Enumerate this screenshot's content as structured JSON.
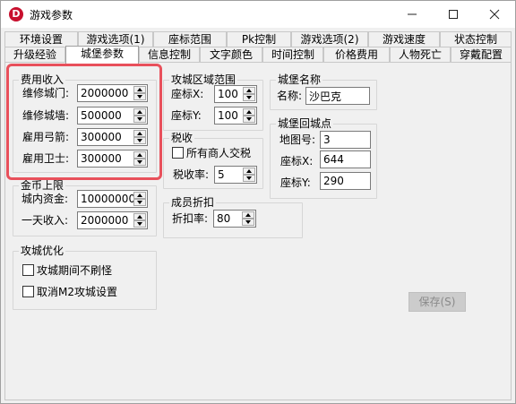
{
  "window": {
    "title": "游戏参数",
    "icon_letter": "D",
    "minimize_symbol": "—",
    "close_symbol": "✕"
  },
  "tabs_row1": [
    "环境设置",
    "游戏选项(1)",
    "座标范围",
    "Pk控制",
    "游戏选项(2)",
    "游戏速度",
    "状态控制"
  ],
  "tabs_row2": [
    "升级经验",
    "城堡参数",
    "信息控制",
    "文字颜色",
    "时间控制",
    "价格费用",
    "人物死亡",
    "穿戴配置"
  ],
  "active_tab": "城堡参数",
  "cost_group": {
    "title": "费用收入",
    "rows": [
      {
        "label": "维修城门:",
        "value": "2000000"
      },
      {
        "label": "维修城墙:",
        "value": "500000"
      },
      {
        "label": "雇用弓箭:",
        "value": "300000"
      },
      {
        "label": "雇用卫士:",
        "value": "300000"
      }
    ]
  },
  "gold_group": {
    "title": "金币上限",
    "rows": [
      {
        "label": "城内资金:",
        "value": "10000000"
      },
      {
        "label": "一天收入:",
        "value": "2000000"
      }
    ]
  },
  "optimize_group": {
    "title": "攻城优化",
    "options": [
      {
        "label": "攻城期间不刷怪",
        "checked": false
      },
      {
        "label": "取消M2攻城设置",
        "checked": false
      }
    ]
  },
  "siege_range_group": {
    "title": "攻城区域范围",
    "rows": [
      {
        "label": "座标X:",
        "value": "100"
      },
      {
        "label": "座标Y:",
        "value": "100"
      }
    ]
  },
  "tax_group": {
    "title": "税收",
    "checkbox_label": "所有商人交税",
    "checkbox_checked": false,
    "rate_label": "税收率:",
    "rate_value": "5"
  },
  "discount_group": {
    "title": "成员折扣",
    "label": "折扣率:",
    "value": "80"
  },
  "castle_name_group": {
    "title": "城堡名称",
    "label": "名称:",
    "value": "沙巴克"
  },
  "return_point_group": {
    "title": "城堡回城点",
    "map_label": "地图号:",
    "map_value": "3",
    "rows": [
      {
        "label": "座标X:",
        "value": "644"
      },
      {
        "label": "座标Y:",
        "value": "290"
      }
    ]
  },
  "save_button": "保存(S)",
  "colors": {
    "highlight": "#e8505b",
    "app_icon": "#c8102e",
    "disabled_button": "#cccccc"
  }
}
